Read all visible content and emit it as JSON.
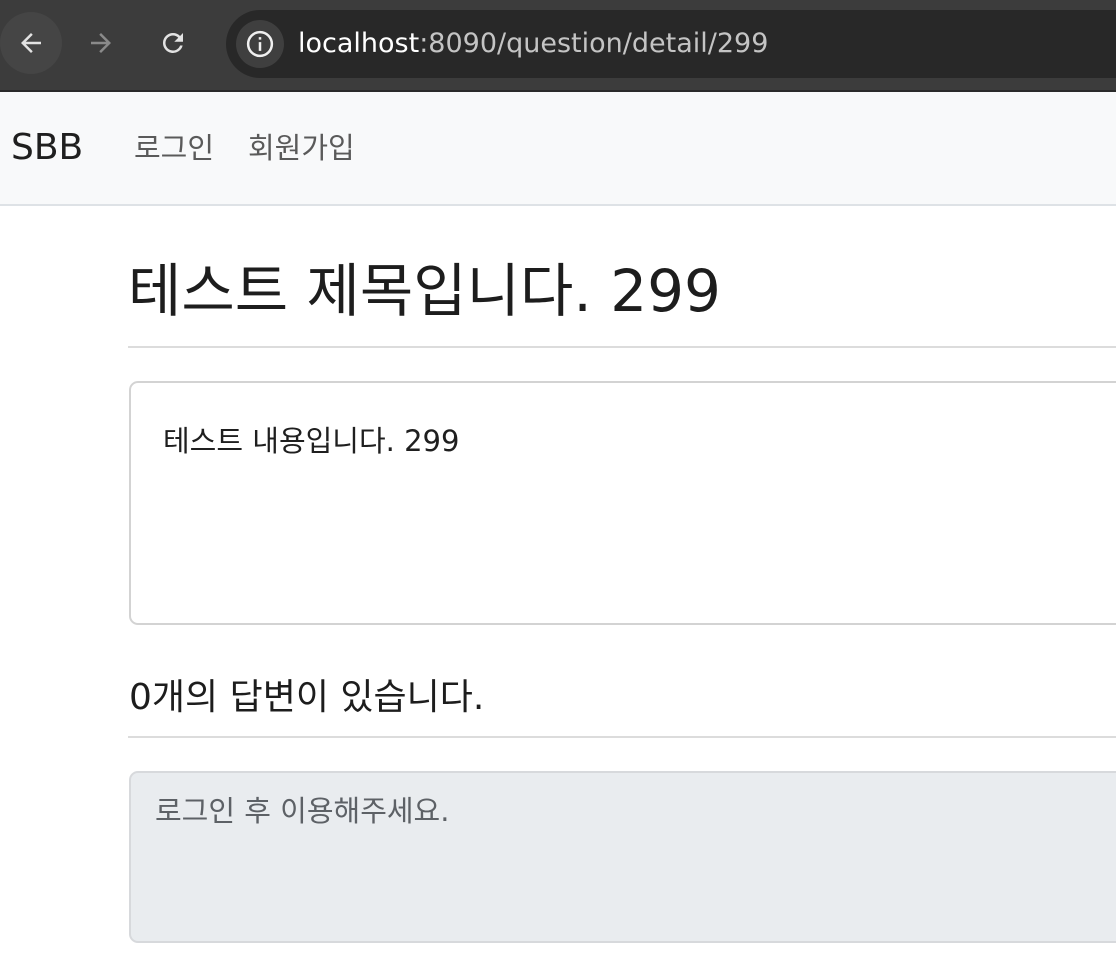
{
  "browser": {
    "url_host": "localhost",
    "url_rest": ":8090/question/detail/299"
  },
  "navbar": {
    "brand": "SBB",
    "login": "로그인",
    "signup": "회원가입"
  },
  "question": {
    "subject": "테스트 제목입니다. 299",
    "content": "테스트 내용입니다. 299"
  },
  "answers": {
    "count_text": "0개의 답변이 있습니다."
  },
  "answer_form": {
    "placeholder": "로그인 후 이용해주세요."
  },
  "icons": {
    "back": "arrow-left-icon",
    "forward": "arrow-right-icon",
    "reload": "reload-icon",
    "site_info": "info-icon"
  }
}
